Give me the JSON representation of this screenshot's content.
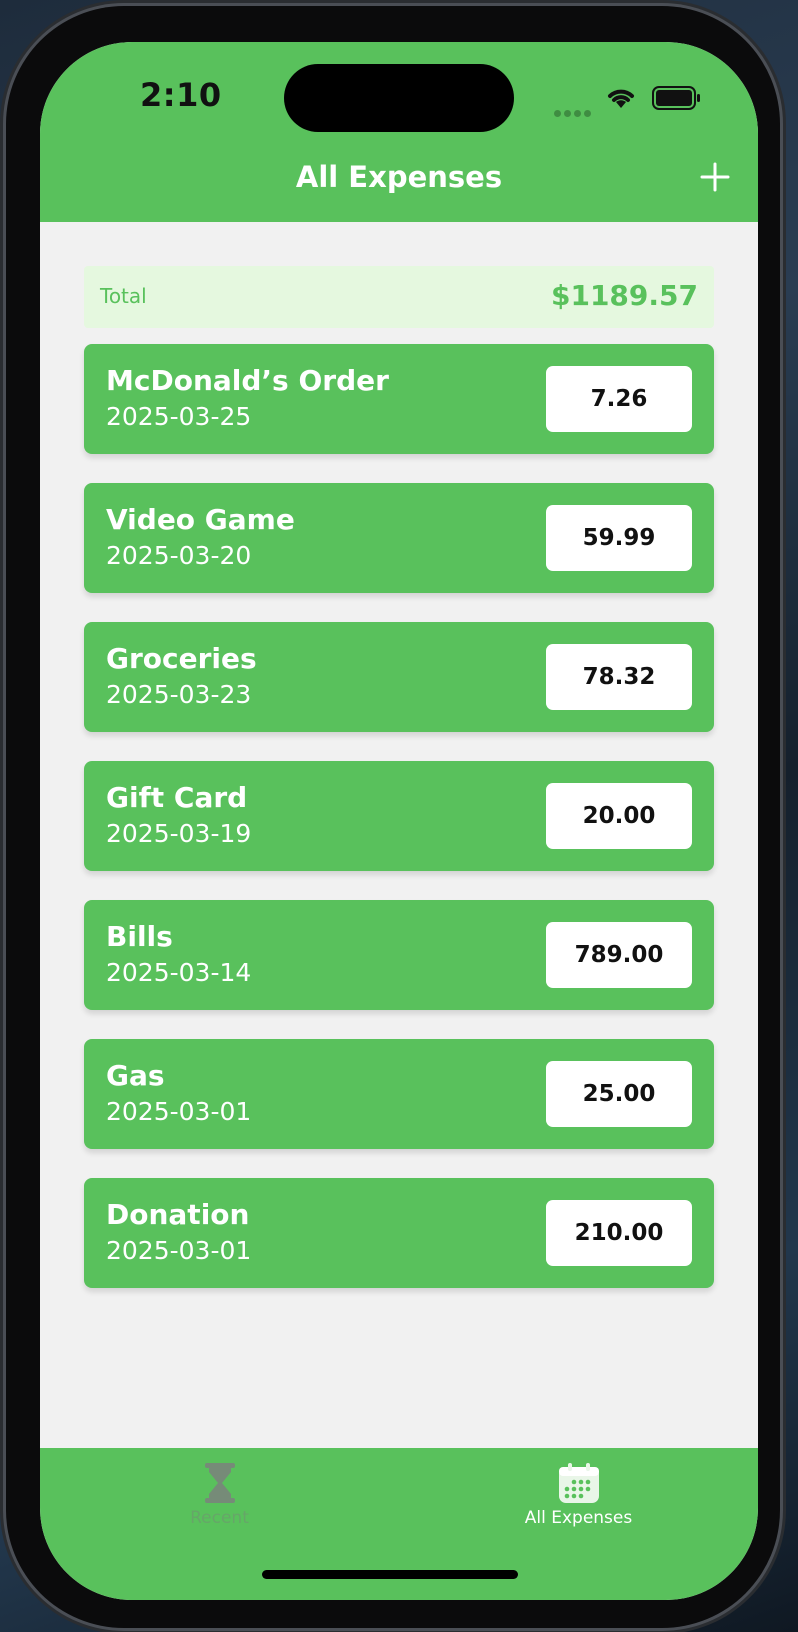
{
  "status_bar": {
    "time": "2:10"
  },
  "nav": {
    "title": "All Expenses",
    "add_icon": "plus-icon"
  },
  "summary": {
    "label": "Total",
    "value": "$1189.57"
  },
  "expenses": [
    {
      "name": "McDonald’s Order",
      "date": "2025-03-25",
      "amount": "7.26"
    },
    {
      "name": "Video Game",
      "date": "2025-03-20",
      "amount": "59.99"
    },
    {
      "name": "Groceries",
      "date": "2025-03-23",
      "amount": "78.32"
    },
    {
      "name": "Gift Card",
      "date": "2025-03-19",
      "amount": "20.00"
    },
    {
      "name": "Bills",
      "date": "2025-03-14",
      "amount": "789.00"
    },
    {
      "name": "Gas",
      "date": "2025-03-01",
      "amount": "25.00"
    },
    {
      "name": "Donation",
      "date": "2025-03-01",
      "amount": "210.00"
    }
  ],
  "tabs": [
    {
      "label": "Recent",
      "icon": "hourglass-icon",
      "selected": false
    },
    {
      "label": "All Expenses",
      "icon": "calendar-icon",
      "selected": true
    }
  ],
  "colors": {
    "accent": "#59c15c",
    "total_background": "#e5f8df",
    "content_background": "#f1f1f1"
  }
}
